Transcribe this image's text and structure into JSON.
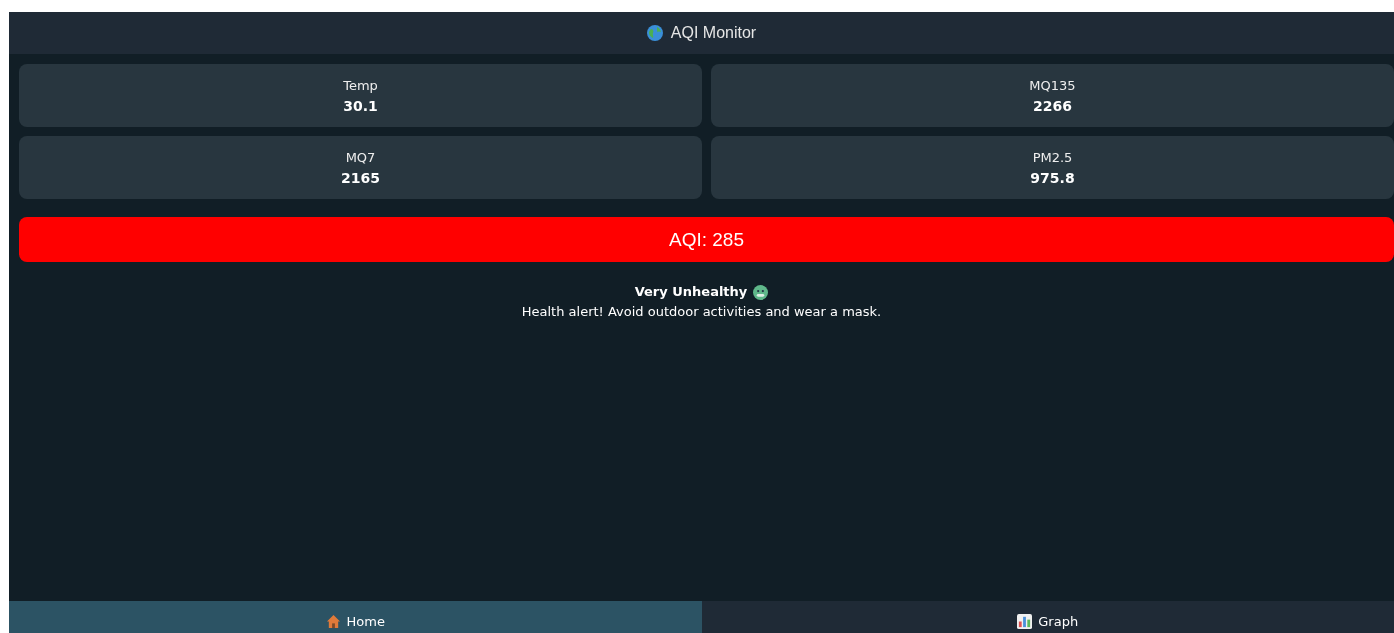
{
  "header": {
    "title": "AQI Monitor"
  },
  "readings": [
    {
      "label": "Temp",
      "value": "30.1"
    },
    {
      "label": "MQ135",
      "value": "2266"
    },
    {
      "label": "MQ7",
      "value": "2165"
    },
    {
      "label": "PM2.5",
      "value": "975.8"
    }
  ],
  "aqi": {
    "text": "AQI: 285"
  },
  "status": {
    "title": "Very Unhealthy",
    "message": "Health alert! Avoid outdoor activities and wear a mask."
  },
  "nav": [
    {
      "label": "Home",
      "selected": true
    },
    {
      "label": "Graph",
      "selected": false
    }
  ]
}
